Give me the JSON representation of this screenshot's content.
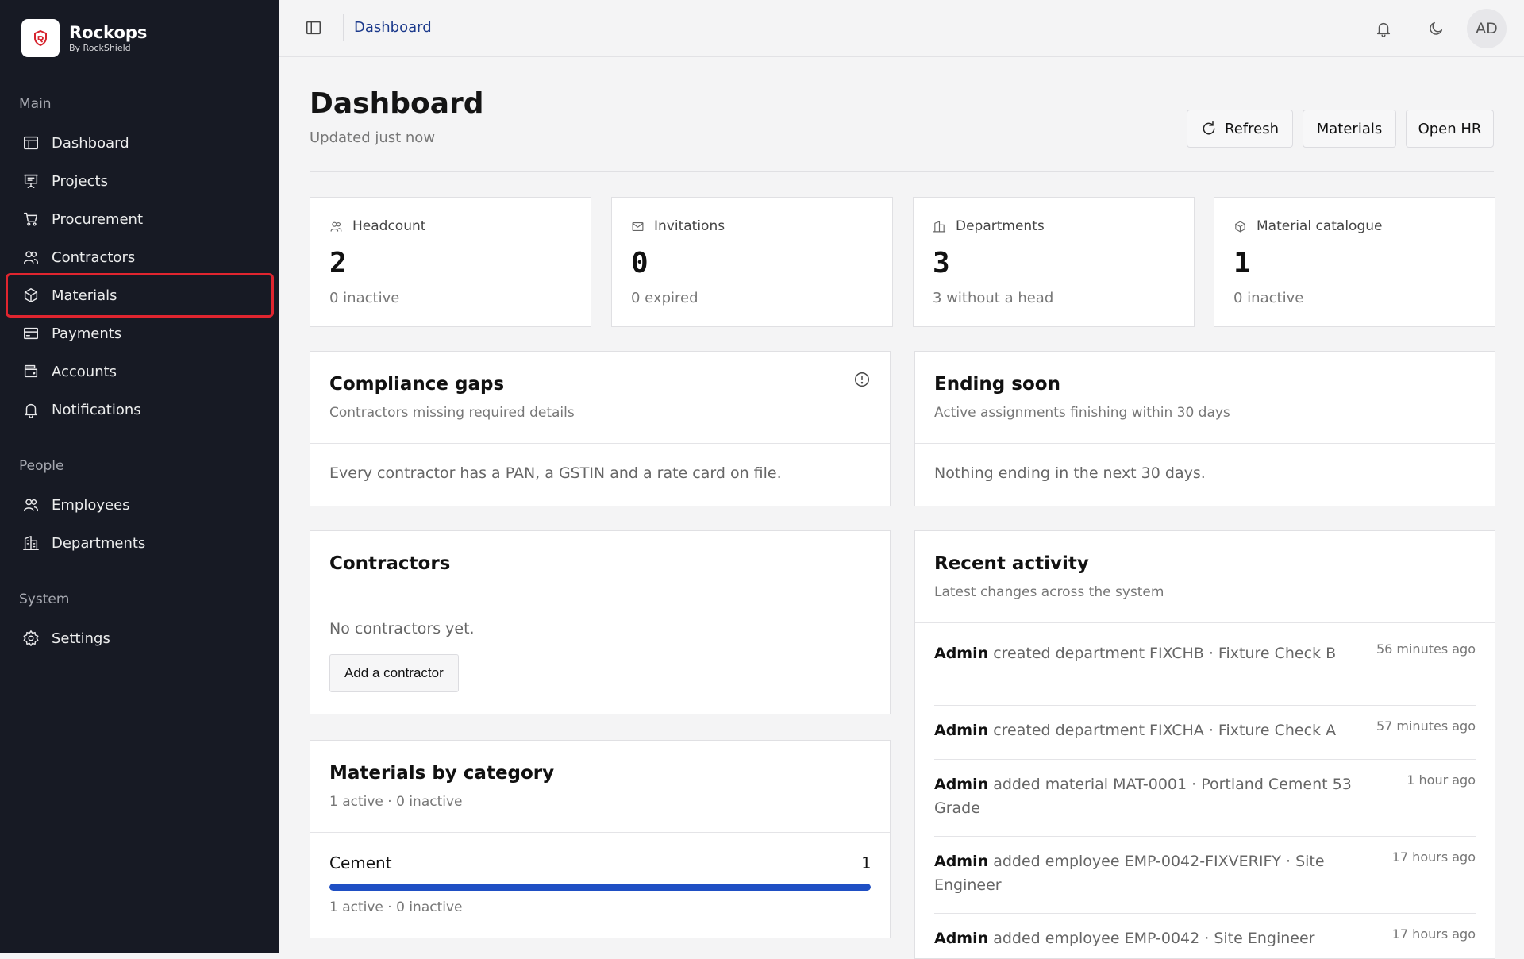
{
  "brand": {
    "name": "Rockops",
    "sub": "By RockShield"
  },
  "sidebar": {
    "sections": [
      "Main",
      "People",
      "System"
    ],
    "main_items": [
      "Dashboard",
      "Projects",
      "Procurement",
      "Contractors",
      "Materials",
      "Payments",
      "Accounts",
      "Notifications"
    ],
    "people_items": [
      "Employees",
      "Departments"
    ],
    "system_items": [
      "Settings"
    ],
    "selected": "Materials",
    "selected_color": "#e0252f"
  },
  "topbar": {
    "breadcrumb": "Dashboard",
    "avatar": "AD"
  },
  "header": {
    "title": "Dashboard",
    "subtitle": "Updated just now",
    "refresh": "Refresh",
    "materials": "Materials",
    "open_hr": "Open HR"
  },
  "stats": [
    {
      "label": "Headcount",
      "value": "2",
      "foot": "0 inactive",
      "icon": "users-icon"
    },
    {
      "label": "Invitations",
      "value": "0",
      "foot": "0 expired",
      "icon": "mail-icon"
    },
    {
      "label": "Departments",
      "value": "3",
      "foot": "3 without a head",
      "icon": "building-icon"
    },
    {
      "label": "Material catalogue",
      "value": "1",
      "foot": "0 inactive",
      "icon": "box-icon"
    }
  ],
  "compliance": {
    "title": "Compliance gaps",
    "sub": "Contractors missing required details",
    "body": "Every contractor has a PAN, a GSTIN and a rate card on file."
  },
  "ending": {
    "title": "Ending soon",
    "sub": "Active assignments finishing within 30 days",
    "body": "Nothing ending in the next 30 days."
  },
  "contractors": {
    "title": "Contractors",
    "body": "No contractors yet.",
    "button": "Add a contractor"
  },
  "materials_cat": {
    "title": "Materials by category",
    "sub": "1 active · 0 inactive",
    "rows": [
      {
        "name": "Cement",
        "count": "1",
        "fraction": 1.0,
        "detail": "1 active · 0 inactive"
      }
    ],
    "bar_color": "#1f4fc4"
  },
  "activity": {
    "title": "Recent activity",
    "sub": "Latest changes across the system",
    "items": [
      {
        "actor": "Admin",
        "text": "created department FIXCHB · Fixture Check B",
        "time": "56 minutes ago"
      },
      {
        "actor": "Admin",
        "text": "created department FIXCHA · Fixture Check A",
        "time": "57 minutes ago"
      },
      {
        "actor": "Admin",
        "text": "added material MAT-0001 · Portland Cement 53 Grade",
        "time": "1 hour ago"
      },
      {
        "actor": "Admin",
        "text": "added employee EMP-0042-FIXVERIFY · Site Engineer",
        "time": "17 hours ago"
      },
      {
        "actor": "Admin",
        "text": "added employee EMP-0042 · Site Engineer",
        "time": "17 hours ago"
      }
    ]
  }
}
